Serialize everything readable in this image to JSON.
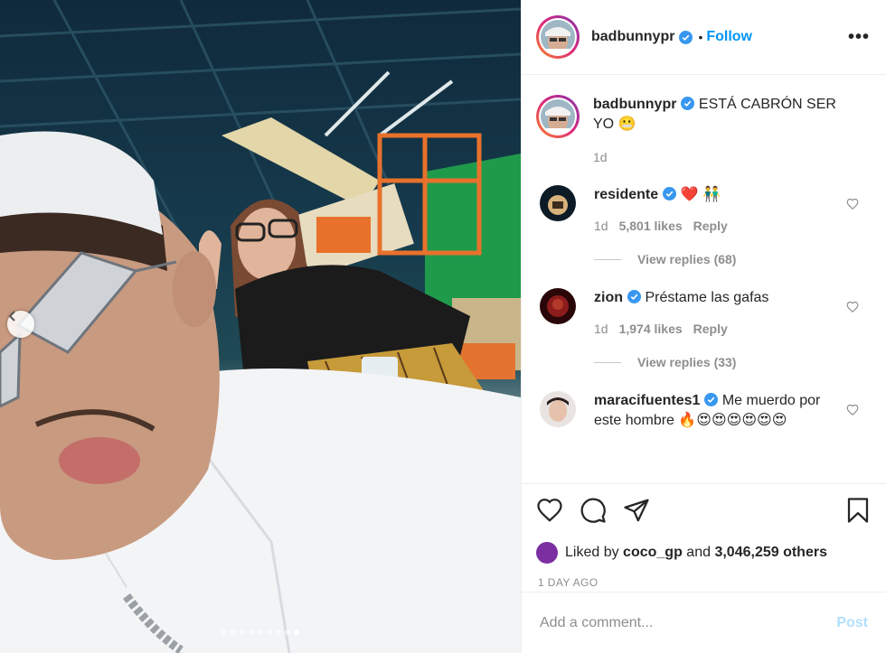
{
  "post": {
    "photo_alt": "",
    "carousel_dots_total": 9,
    "carousel_active_index": 8
  },
  "header": {
    "username": "badbunnypr",
    "separator": "•",
    "follow_label": "Follow",
    "more_icon": "more-horizontal-icon",
    "more_label": "•••"
  },
  "caption": {
    "username": "badbunnypr",
    "text": "ESTÁ CABRÓN SER YO 😬",
    "time": "1d"
  },
  "comments": [
    {
      "username": "residente",
      "verified": true,
      "text": "❤️ 👬",
      "time": "1d",
      "likes": "5,801 likes",
      "reply_label": "Reply",
      "view_replies": "View replies (68)"
    },
    {
      "username": "zion",
      "verified": true,
      "text": "Préstame las gafas",
      "time": "1d",
      "likes": "1,974 likes",
      "reply_label": "Reply",
      "view_replies": "View replies (33)"
    },
    {
      "username": "maracifuentes1",
      "verified": true,
      "text": "Me muerdo por este hombre 🔥😍😍😍😍😍😍"
    }
  ],
  "actions": {
    "liked_prefix": "Liked by",
    "liked_user": "coco_gp",
    "liked_and": "and",
    "liked_count": "3,046,259 others",
    "timestamp": "1 DAY AGO"
  },
  "add_comment": {
    "placeholder": "Add a comment...",
    "post_label": "Post"
  },
  "colors": {
    "accent": "#0095f6",
    "post_disabled": "#b2dffc",
    "verified": "#3897f0",
    "heart_red": "#ed4956"
  }
}
